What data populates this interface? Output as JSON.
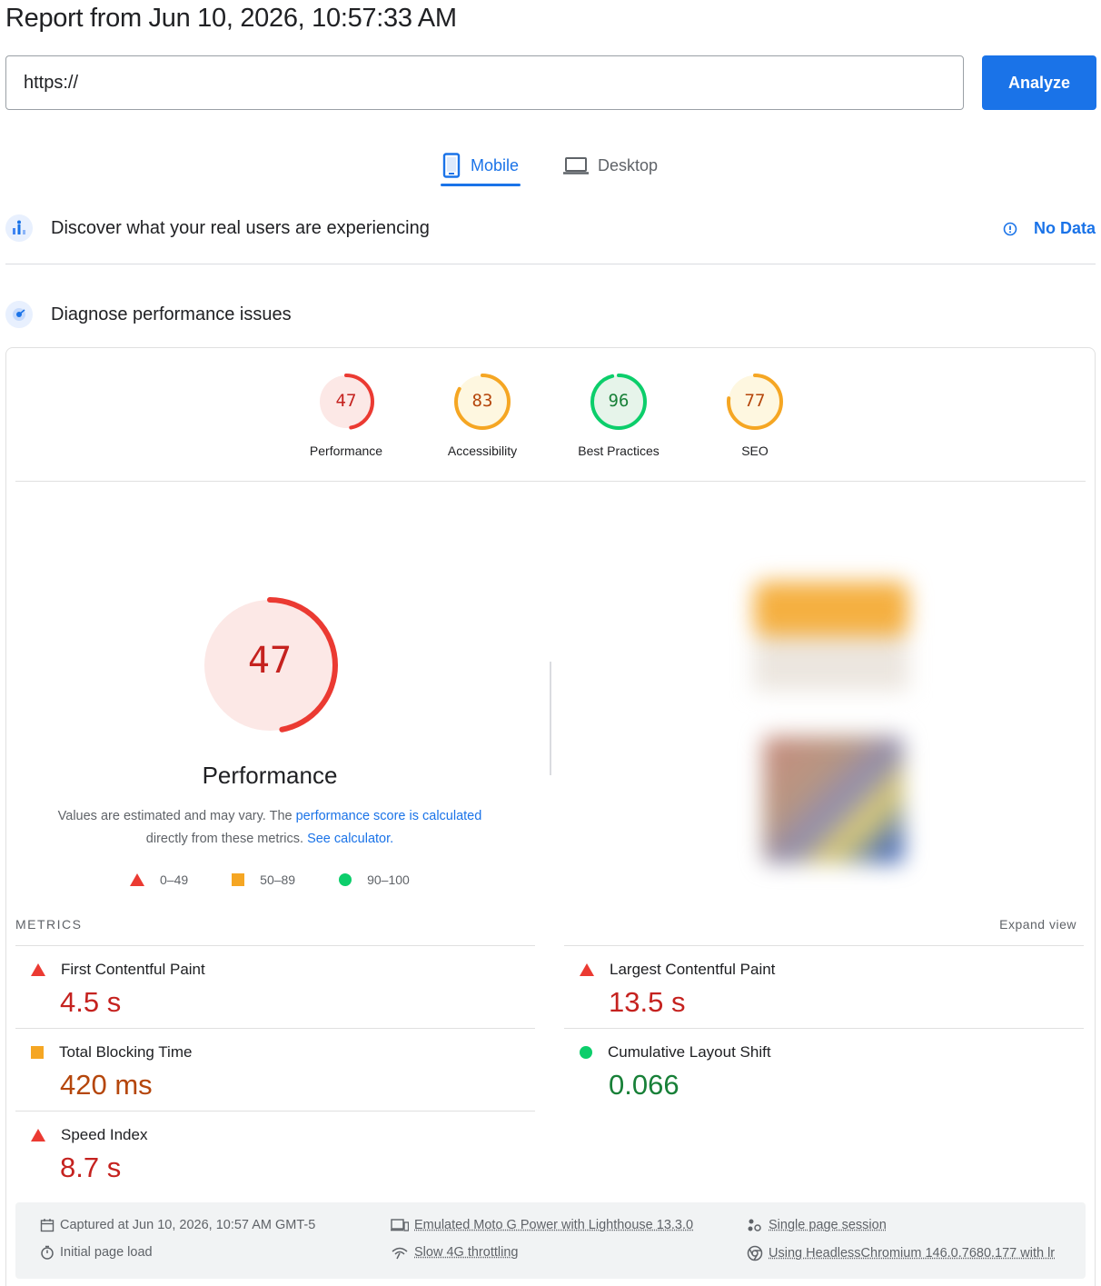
{
  "page": {
    "title": "Report from Jun 10, 2026, 10:57:33 AM"
  },
  "search": {
    "value": "https://",
    "button": "Analyze"
  },
  "tabs": [
    {
      "label": "Mobile",
      "icon": "phone-icon",
      "active": true
    },
    {
      "label": "Desktop",
      "icon": "laptop-icon",
      "active": false
    }
  ],
  "crux": {
    "title": "Discover what your real users are experiencing",
    "status": "No Data"
  },
  "diagnose": {
    "title": "Diagnose performance issues"
  },
  "categories": [
    {
      "label": "Performance",
      "score": 47,
      "color": "#eb3a32",
      "bg": "#fce8e6",
      "text": "#c5221f"
    },
    {
      "label": "Accessibility",
      "score": 83,
      "color": "#f5a623",
      "bg": "#fef7e0",
      "text": "#b5460b"
    },
    {
      "label": "Best Practices",
      "score": 96,
      "color": "#0cce6b",
      "bg": "#e6f4ea",
      "text": "#188038"
    },
    {
      "label": "SEO",
      "score": 77,
      "color": "#f5a623",
      "bg": "#fef7e0",
      "text": "#b5460b"
    }
  ],
  "performance": {
    "score": "47",
    "title": "Performance",
    "desc_before": "Values are estimated and may vary. The ",
    "desc_link1": "performance score is calculated",
    "desc_middle": " directly from these metrics. ",
    "desc_link2": "See calculator.",
    "legend": {
      "poor": "0–49",
      "average": "50–89",
      "good": "90–100"
    }
  },
  "metrics": {
    "label": "METRICS",
    "expand": "Expand view",
    "items": [
      {
        "name": "First Contentful Paint",
        "value": "4.5 s",
        "rating": "poor"
      },
      {
        "name": "Largest Contentful Paint",
        "value": "13.5 s",
        "rating": "poor"
      },
      {
        "name": "Total Blocking Time",
        "value": "420 ms",
        "rating": "average"
      },
      {
        "name": "Cumulative Layout Shift",
        "value": "0.066",
        "rating": "good"
      },
      {
        "name": "Speed Index",
        "value": "8.7 s",
        "rating": "poor"
      }
    ]
  },
  "footer": {
    "captured": "Captured at Jun 10, 2026, 10:57 AM GMT-5",
    "load": "Initial page load",
    "device": "Emulated Moto G Power with Lighthouse 13.3.0",
    "throttling": "Slow 4G throttling",
    "session": "Single page session",
    "browser": "Using HeadlessChromium 146.0.7680.177 with lr"
  }
}
